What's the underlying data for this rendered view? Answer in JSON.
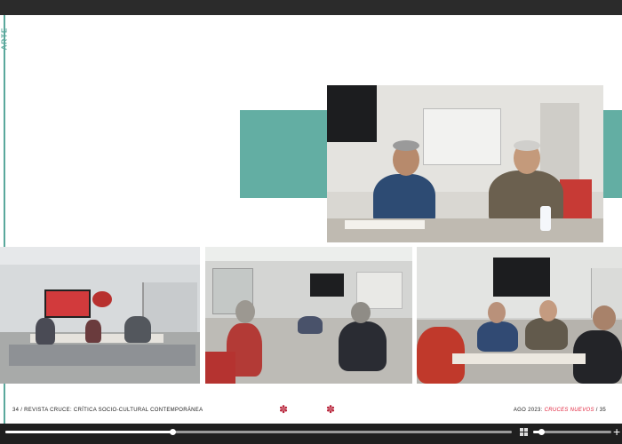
{
  "viewer": {
    "progress_fraction": 0.33,
    "zoom_fraction": 0.1,
    "icons": [
      "grid-view-icon",
      "zoom-in-icon"
    ]
  },
  "magazine": {
    "section_label": "ARTE",
    "footer_left": "34 / REVISTA CRUCE: CRÍTICA SOCIO-CULTURAL CONTEMPORÁNEA",
    "footer_right_prefix": "AGO 2023:",
    "footer_right_accent": "CRUCES NUEVOS",
    "footer_right_suffix": "/ 35",
    "ornament_left": "✽",
    "ornament_right": "✽",
    "accent_color": "#63aea3",
    "footer_accent_color": "#e0223b"
  }
}
